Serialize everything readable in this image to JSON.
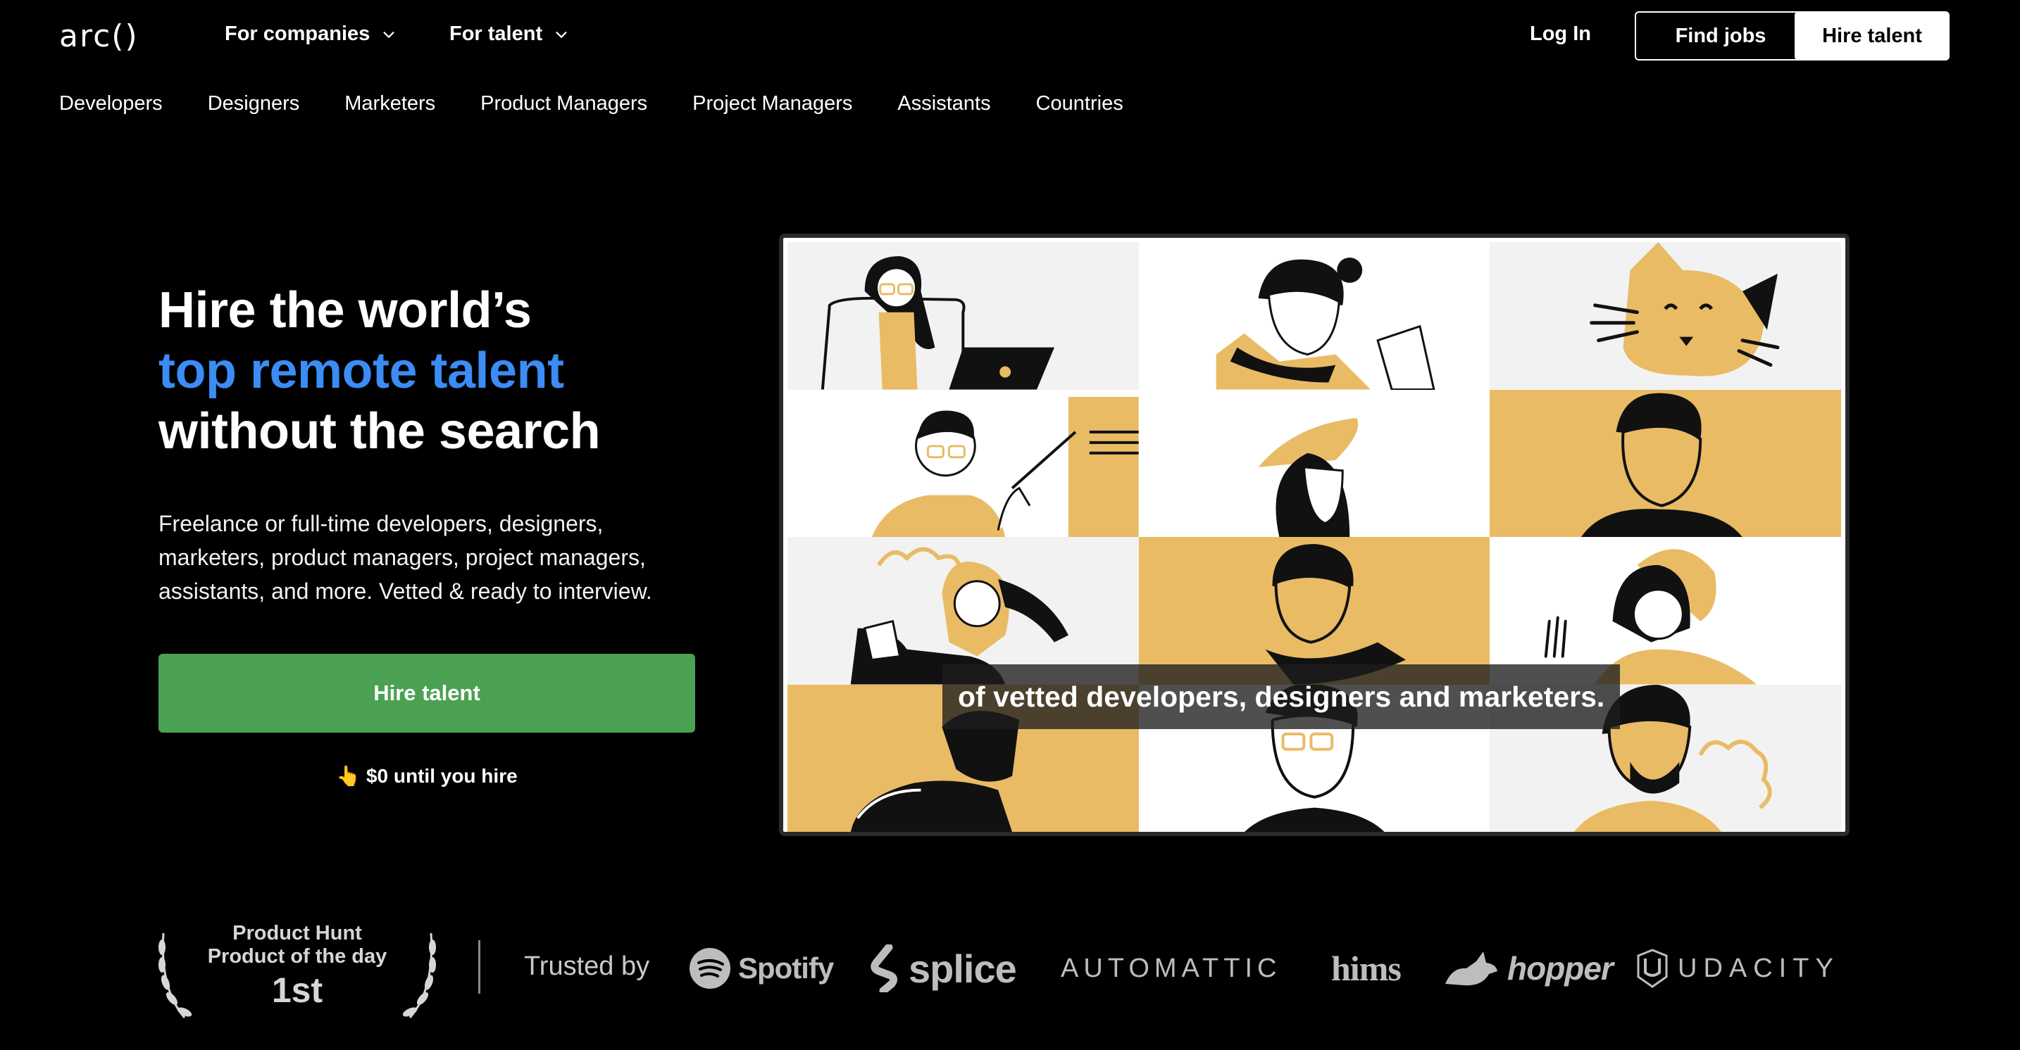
{
  "nav": {
    "logo": "arc()",
    "companies": "For companies",
    "talent": "For talent",
    "login": "Log In",
    "find_jobs": "Find jobs",
    "hire_talent": "Hire talent"
  },
  "categories": [
    "Developers",
    "Designers",
    "Marketers",
    "Product Managers",
    "Project Managers",
    "Assistants",
    "Countries"
  ],
  "hero": {
    "line1": "Hire the world’s",
    "line2": "top remote talent",
    "line3": "without the search",
    "desc_line1": "Freelance or full-time developers, designers,",
    "desc_line2": "marketers, product managers, project managers,",
    "desc_line3": "assistants, and more. Vetted & ready to interview.",
    "cta": "Hire talent",
    "cta_note": "👆 $0 until you hire"
  },
  "video": {
    "caption": "of vetted developers, designers and marketers.",
    "accent_color": "#e9bb65"
  },
  "trust": {
    "ph_line1": "Product Hunt",
    "ph_line2": "Product of the day",
    "ph_rank": "1st",
    "label": "Trusted by",
    "logos": {
      "spotify": "Spotify",
      "splice": "splice",
      "automattic": "AUTOMATTIC",
      "hims": "hims",
      "hopper": "hopper",
      "udacity": "UDACITY"
    }
  },
  "colors": {
    "brand_blue": "#3b8cf5",
    "cta_green": "#4aa152",
    "background": "#000000"
  }
}
